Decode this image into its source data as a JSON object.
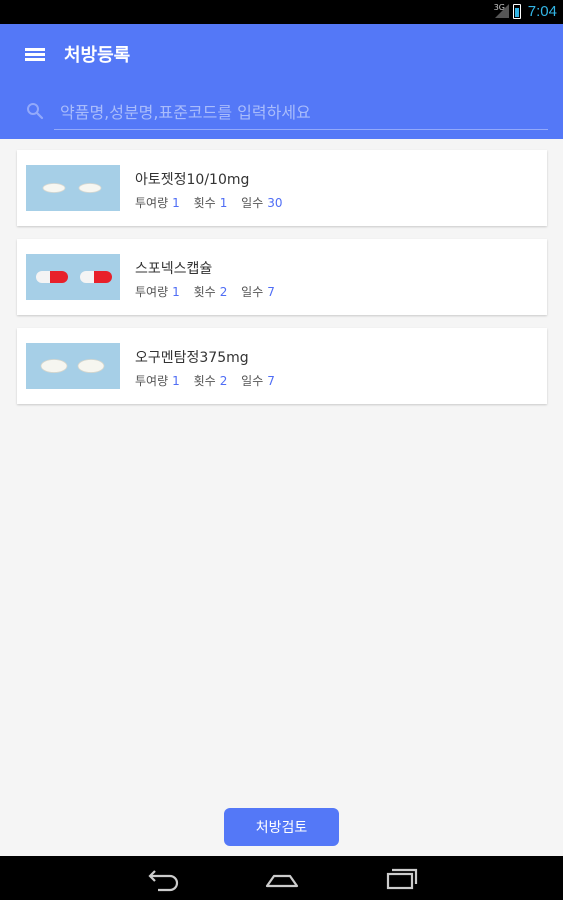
{
  "status_bar": {
    "network": "3G",
    "time": "7:04"
  },
  "app_bar": {
    "title": "처방등록",
    "search_placeholder": "약품명,성분명,표준코드를 입력하세요"
  },
  "medications": [
    {
      "name": "아토젯정10/10mg",
      "dose_label": "투여량",
      "dose": "1",
      "freq_label": "횟수",
      "freq": "1",
      "days_label": "일수",
      "days": "30",
      "pill_type": "small-white-tablet"
    },
    {
      "name": "스포넥스캡슐",
      "dose_label": "투여량",
      "dose": "1",
      "freq_label": "횟수",
      "freq": "2",
      "days_label": "일수",
      "days": "7",
      "pill_type": "red-white-capsule"
    },
    {
      "name": "오구멘탐정375mg",
      "dose_label": "투여량",
      "dose": "1",
      "freq_label": "횟수",
      "freq": "2",
      "days_label": "일수",
      "days": "7",
      "pill_type": "large-white-tablet"
    }
  ],
  "actions": {
    "review_label": "처방검토"
  },
  "nav": {
    "back": "back-icon",
    "home": "home-icon",
    "recents": "recents-icon"
  },
  "colors": {
    "primary": "#5478f7",
    "value_text": "#4f6df5",
    "status_accent": "#33b5e5"
  }
}
